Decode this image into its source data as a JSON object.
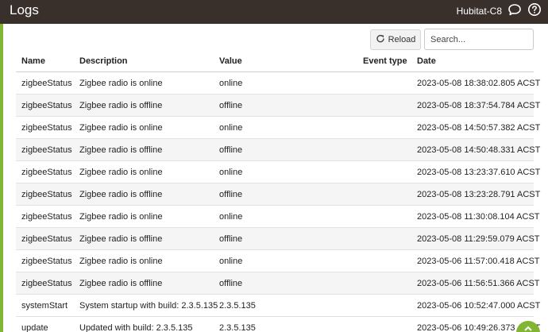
{
  "header": {
    "title": "Logs",
    "hub_name": "Hubitat-C8"
  },
  "toolbar": {
    "reload_label": "Reload",
    "search_placeholder": "Search..."
  },
  "table": {
    "columns": [
      "Name",
      "Description",
      "Value",
      "Event type",
      "Date"
    ],
    "rows": [
      {
        "name": "zigbeeStatus",
        "description": "Zigbee radio is online",
        "value": "online",
        "event_type": "",
        "date": "2023-05-08 18:38:02.805 ACST"
      },
      {
        "name": "zigbeeStatus",
        "description": "Zigbee radio is offline",
        "value": "offline",
        "event_type": "",
        "date": "2023-05-08 18:37:54.784 ACST"
      },
      {
        "name": "zigbeeStatus",
        "description": "Zigbee radio is online",
        "value": "online",
        "event_type": "",
        "date": "2023-05-08 14:50:57.382 ACST"
      },
      {
        "name": "zigbeeStatus",
        "description": "Zigbee radio is offline",
        "value": "offline",
        "event_type": "",
        "date": "2023-05-08 14:50:48.331 ACST"
      },
      {
        "name": "zigbeeStatus",
        "description": "Zigbee radio is online",
        "value": "online",
        "event_type": "",
        "date": "2023-05-08 13:23:37.610 ACST"
      },
      {
        "name": "zigbeeStatus",
        "description": "Zigbee radio is offline",
        "value": "offline",
        "event_type": "",
        "date": "2023-05-08 13:23:28.791 ACST"
      },
      {
        "name": "zigbeeStatus",
        "description": "Zigbee radio is online",
        "value": "online",
        "event_type": "",
        "date": "2023-05-08 11:30:08.104 ACST"
      },
      {
        "name": "zigbeeStatus",
        "description": "Zigbee radio is offline",
        "value": "offline",
        "event_type": "",
        "date": "2023-05-08 11:29:59.079 ACST"
      },
      {
        "name": "zigbeeStatus",
        "description": "Zigbee radio is online",
        "value": "online",
        "event_type": "",
        "date": "2023-05-06 11:57:00.418 ACST"
      },
      {
        "name": "zigbeeStatus",
        "description": "Zigbee radio is offline",
        "value": "offline",
        "event_type": "",
        "date": "2023-05-06 11:56:51.366 ACST"
      },
      {
        "name": "systemStart",
        "description": "System startup with build: 2.3.5.135",
        "value": "2.3.5.135",
        "event_type": "",
        "date": "2023-05-06 10:52:47.000 ACST"
      },
      {
        "name": "update",
        "description": "Updated with build: 2.3.5.135",
        "value": "2.3.5.135",
        "event_type": "",
        "date": "2023-05-06 10:49:26.373 ACST"
      }
    ]
  },
  "icons": {
    "chat": "chat-bubble-icon",
    "help": "help-icon",
    "reload": "refresh-icon",
    "fab": "chevron-up-icon"
  },
  "colors": {
    "topbar": "#3a302b",
    "accent": "#81b532",
    "row_shade": "#f5f5f5"
  }
}
